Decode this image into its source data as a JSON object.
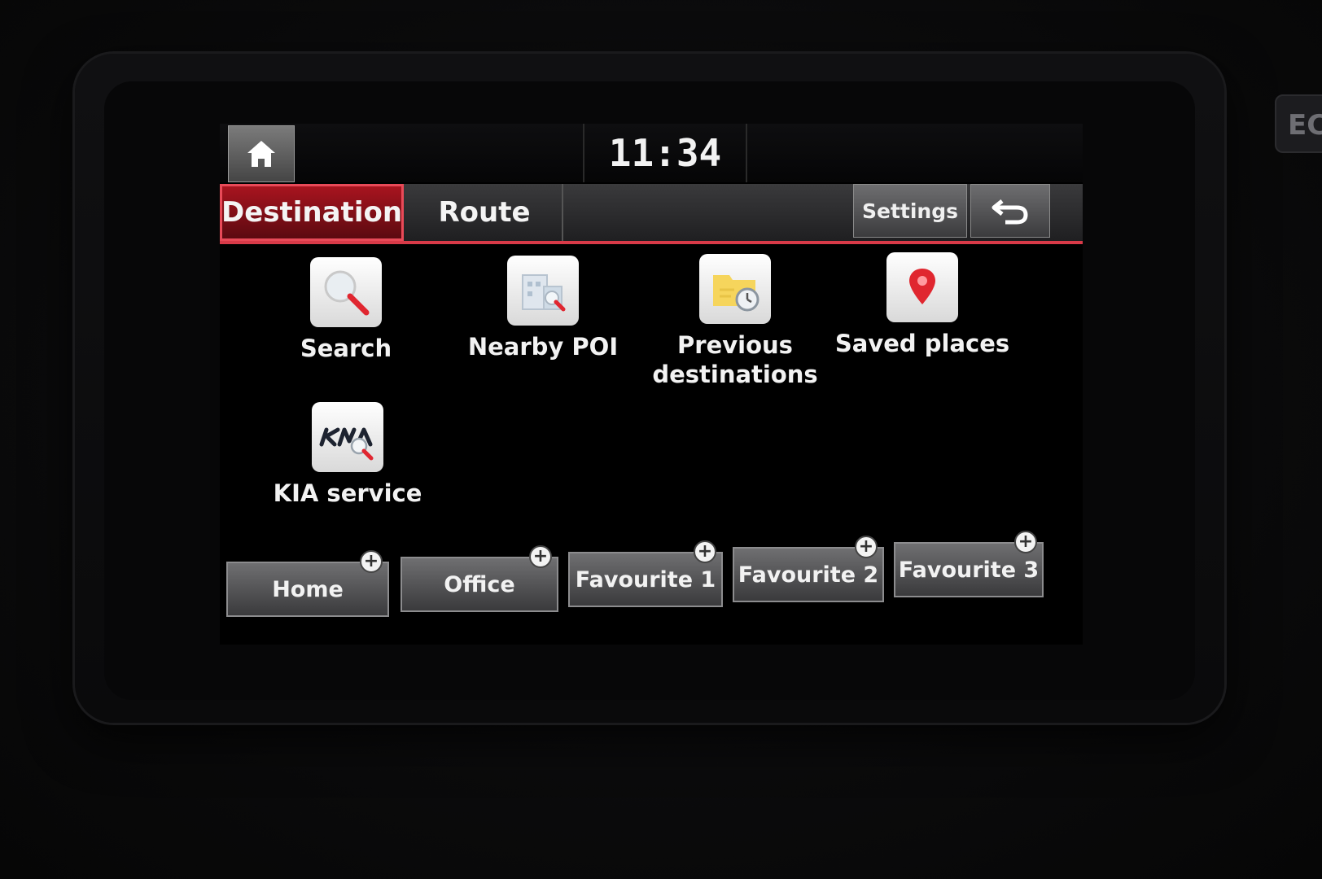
{
  "status_bar": {
    "clock": "11:34"
  },
  "tabs": {
    "destination_label": "Destination",
    "route_label": "Route",
    "settings_label": "Settings"
  },
  "menu_items": [
    {
      "label": "Search",
      "icon": "search-icon"
    },
    {
      "label": "Nearby POI",
      "icon": "nearby-poi-icon"
    },
    {
      "label_line1": "Previous",
      "label_line2": "destinations",
      "icon": "previous-destinations-icon"
    },
    {
      "label": "Saved places",
      "icon": "saved-places-icon"
    },
    {
      "label": "KIA service",
      "icon": "kia-service-icon"
    }
  ],
  "favourites": [
    {
      "label": "Home"
    },
    {
      "label": "Office"
    },
    {
      "label": "Favourite 1"
    },
    {
      "label": "Favourite 2"
    },
    {
      "label": "Favourite 3"
    }
  ],
  "hardware": {
    "side_button_text": "EC"
  },
  "colors": {
    "accent_red": "#d83a48",
    "active_tab": "#a8141f",
    "button_gray": "#5a5a5c"
  }
}
